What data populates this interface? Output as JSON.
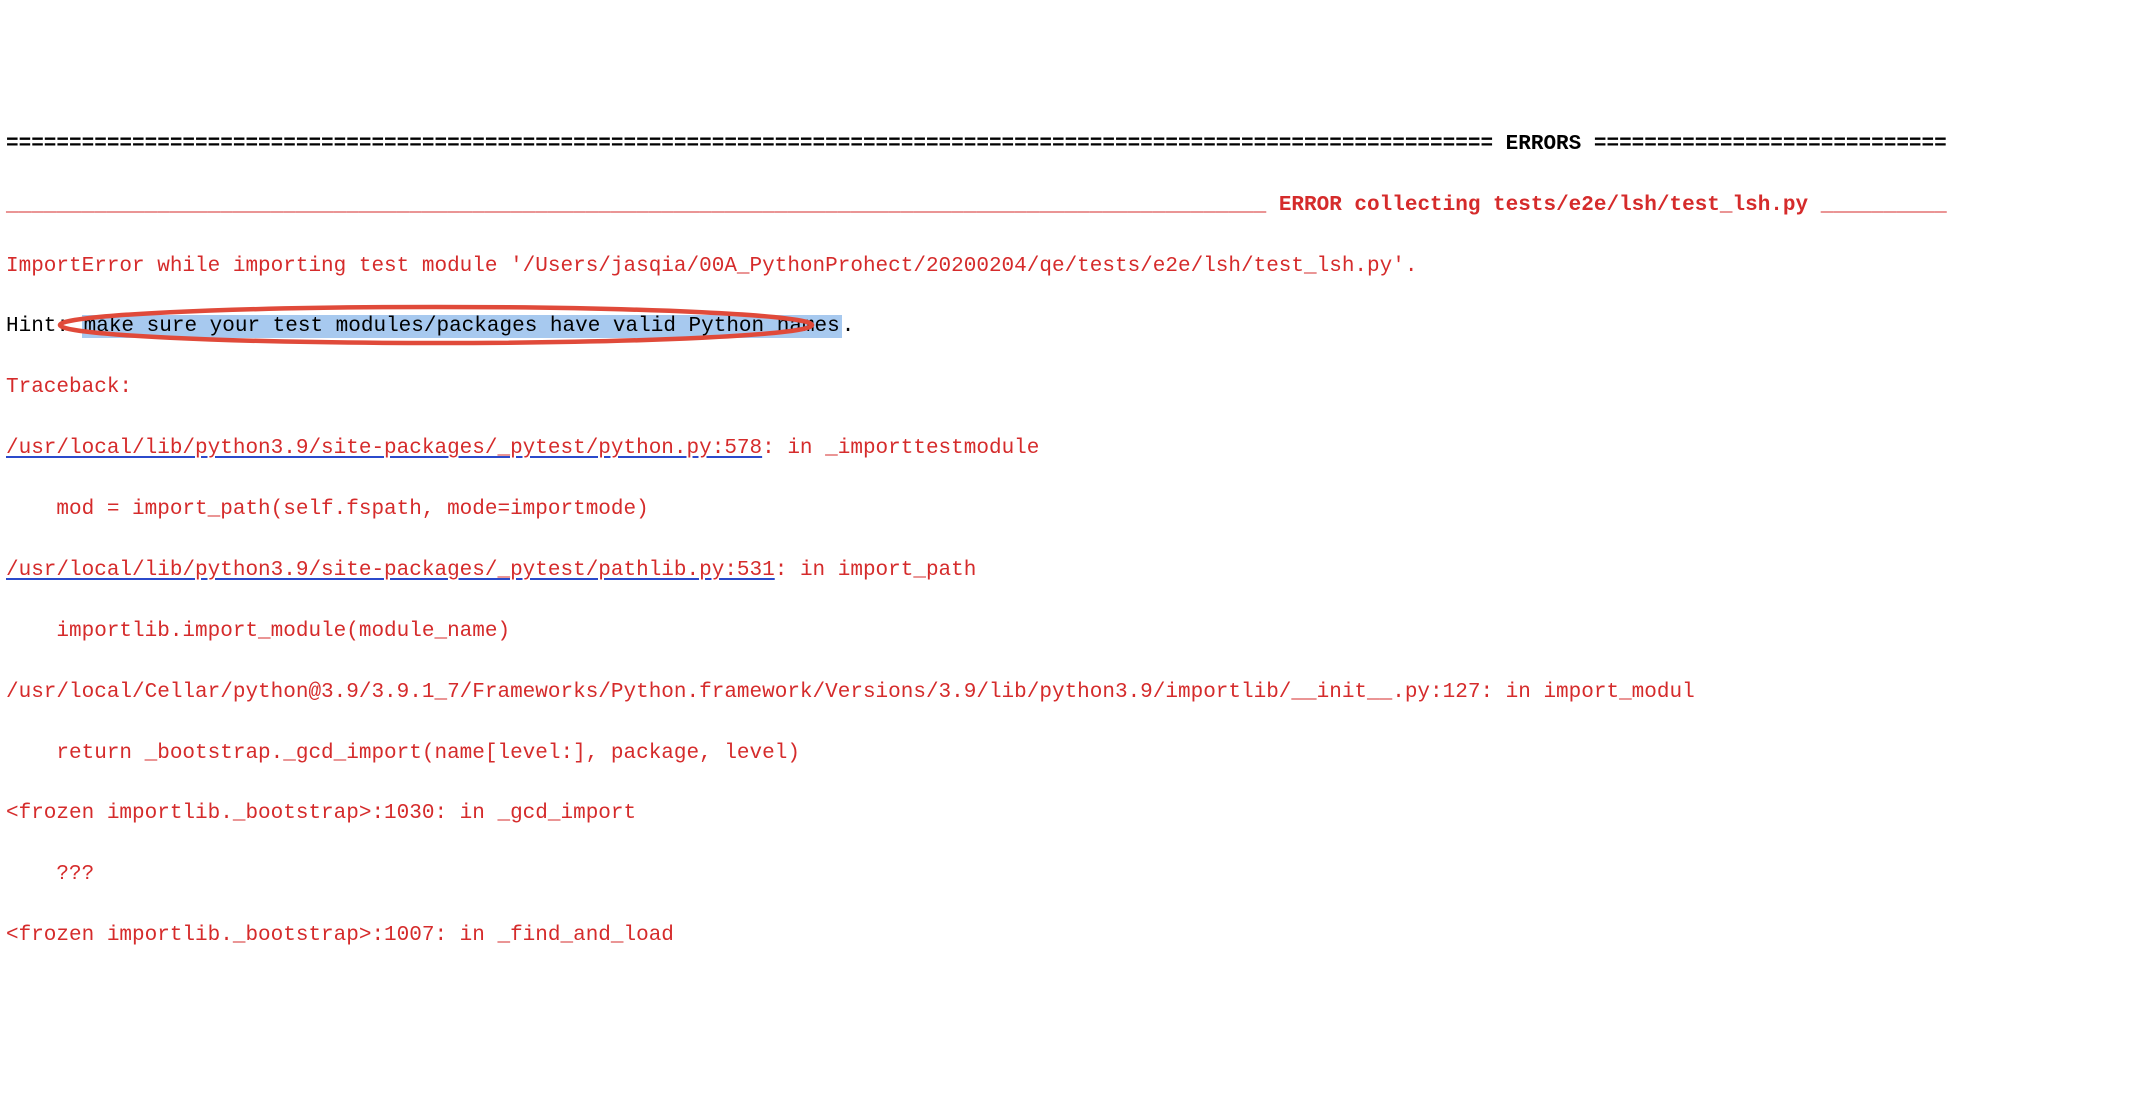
{
  "header": {
    "divider_pre": "======================================================================================================================",
    "label": " ERRORS ",
    "divider_post": "============================"
  },
  "error_banner": {
    "underscore_pre": "____________________________________________________________________________________________________",
    "label": " ERROR collecting tests/e2e/lsh/test_lsh.py ",
    "underscore_post": "__________"
  },
  "import_error_line": "ImportError while importing test module '/Users/jasqia/00A_PythonProhect/20200204/qe/tests/e2e/lsh/test_lsh.py'.",
  "hint_prefix": "Hint: ",
  "hint_highlight": "make sure your test modules/packages have valid Python names",
  "hint_suffix": ".",
  "traceback_label": "Traceback:",
  "tb": {
    "l1_link": "/usr/local/lib/python3.9/site-packages/_pytest/python.py:578",
    "l1_rest": ": in _importtestmodule",
    "l2": "    mod = import_path(self.fspath, mode=importmode)",
    "l3_link": "/usr/local/lib/python3.9/site-packages/_pytest/pathlib.py:531",
    "l3_rest": ": in import_path",
    "l4": "    importlib.import_module(module_name)",
    "l5": "/usr/local/Cellar/python@3.9/3.9.1_7/Frameworks/Python.framework/Versions/3.9/lib/python3.9/importlib/__init__.py:127: in import_modul",
    "l6": "    return _bootstrap._gcd_import(name[level:], package, level)",
    "l7": "<frozen importlib._bootstrap>:1030: in _gcd_import",
    "l8": "    ???",
    "l9": "<frozen importlib._bootstrap>:1007: in _find_and_load"
  },
  "colors": {
    "red": "#d52b2b",
    "link_underline": "#2b4acb",
    "highlight_bg": "#a7c9ef",
    "ellipse_stroke": "#e04a3a"
  }
}
